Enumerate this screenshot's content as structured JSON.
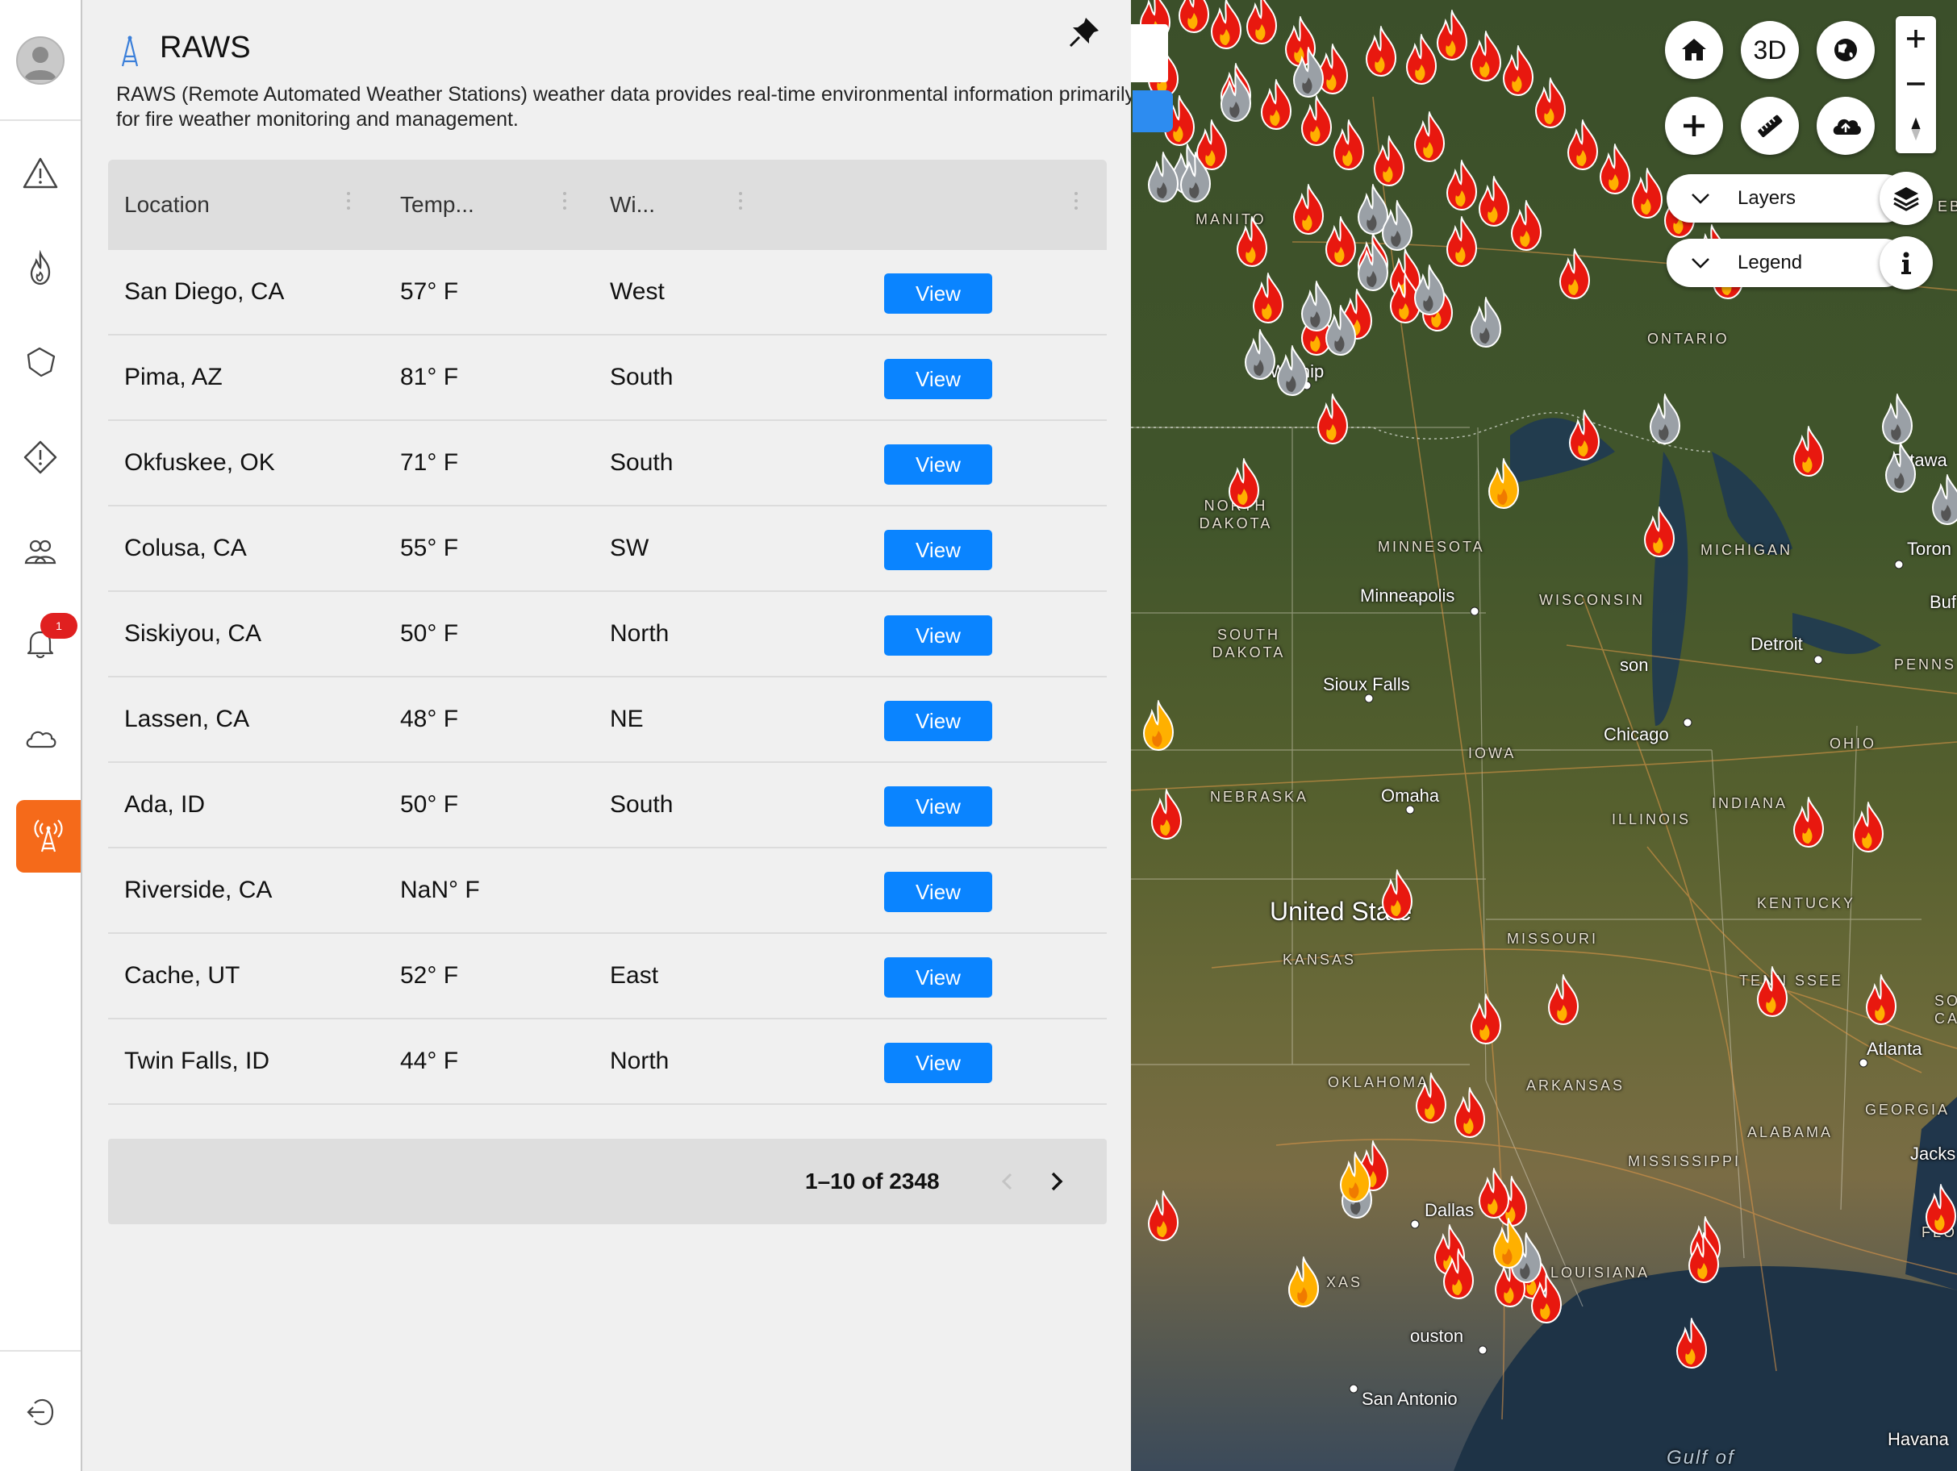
{
  "sidebar": {
    "items": [
      {
        "name": "alerts-icon"
      },
      {
        "name": "fire-icon"
      },
      {
        "name": "perimeter-icon"
      },
      {
        "name": "warning-icon"
      },
      {
        "name": "community-icon"
      },
      {
        "name": "notifications-icon",
        "badge": "1"
      },
      {
        "name": "weather-cloud-icon"
      },
      {
        "name": "raws-station-icon",
        "active": true
      }
    ],
    "colors": {
      "active": "#f56a1a",
      "badge": "#e02020"
    }
  },
  "panel": {
    "title": "RAWS",
    "description": "RAWS (Remote Automated Weather Stations) weather data provides real-time environmental information primarily used for fire weather monitoring and management.",
    "columns": {
      "location": "Location",
      "temp": "Temp...",
      "wind": "Wi..."
    },
    "rows": [
      {
        "location": "San Diego, CA",
        "temp": "57° F",
        "wind": "West",
        "action": "View"
      },
      {
        "location": "Pima, AZ",
        "temp": "81° F",
        "wind": "South",
        "action": "View"
      },
      {
        "location": "Okfuskee, OK",
        "temp": "71° F",
        "wind": "South",
        "action": "View"
      },
      {
        "location": "Colusa, CA",
        "temp": "55° F",
        "wind": "SW",
        "action": "View"
      },
      {
        "location": "Siskiyou, CA",
        "temp": "50° F",
        "wind": "North",
        "action": "View"
      },
      {
        "location": "Lassen, CA",
        "temp": "48° F",
        "wind": "NE",
        "action": "View"
      },
      {
        "location": "Ada, ID",
        "temp": "50° F",
        "wind": "South",
        "action": "View"
      },
      {
        "location": "Riverside, CA",
        "temp": "NaN° F",
        "wind": "",
        "action": "View"
      },
      {
        "location": "Cache, UT",
        "temp": "52° F",
        "wind": "East",
        "action": "View"
      },
      {
        "location": "Twin Falls, ID",
        "temp": "44° F",
        "wind": "North",
        "action": "View"
      }
    ],
    "pagination": {
      "range": "1–10 of 2348"
    },
    "colors": {
      "view_button": "#0a84ff"
    }
  },
  "map": {
    "tools": {
      "three_d": "3D"
    },
    "layers_label": "Layers",
    "legend_label": "Legend",
    "labels": {
      "cities": [
        "Winnip",
        "Minneapolis",
        "Sioux Falls",
        "Omaha",
        "Chicago",
        "Detroit",
        "Ottawa",
        "Toron",
        "Buf",
        "Atlanta",
        "Jacks",
        "Dallas",
        "ouston",
        "San Antonio",
        "Havana",
        "son"
      ],
      "regions": [
        "MANITO",
        "ONTARIO",
        "NORTH DAKOTA",
        "MINNESOTA",
        "MICHIGAN",
        "WISCONSIN",
        "SOUTH DAKOTA",
        "IOWA",
        "PENNS",
        "OHIO",
        "NEBRASKA",
        "ILLINOIS",
        "INDIANA",
        "KENTUCKY",
        "MISSOURI",
        "KANSAS",
        "TENN SSEE",
        "SO CAR",
        "OKLAHOMA",
        "ARKANSAS",
        "GEORGIA",
        "ALABAMA",
        "MISSISSIPPI",
        "LOUISIANA",
        "XAS",
        "FLO",
        "EB"
      ],
      "country": "United State",
      "water": "Gulf of"
    },
    "colors": {
      "fire": "#e8180f",
      "fire_core": "#ffb000",
      "contained": "#9aa0a6"
    }
  }
}
